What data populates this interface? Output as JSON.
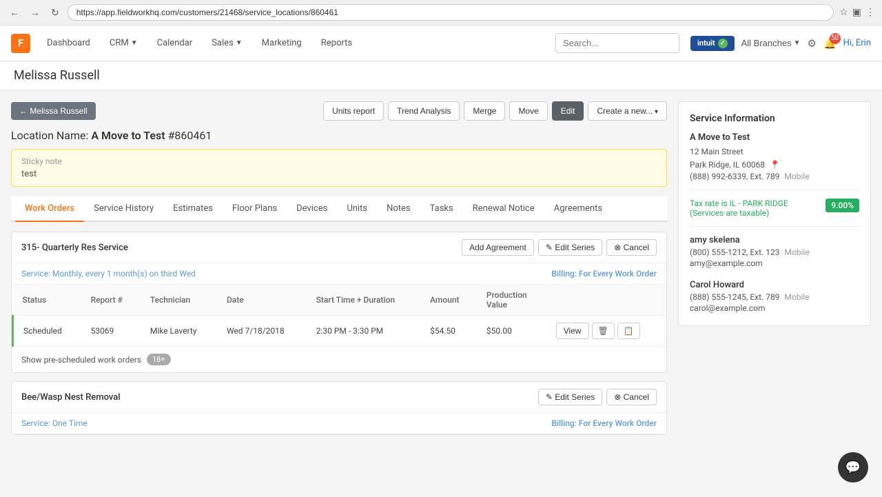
{
  "browser": {
    "url": "https://app.fieldworkhq.com/customers/21468/service_locations/860461"
  },
  "nav": {
    "logo": "F",
    "items": [
      {
        "label": "Dashboard",
        "id": "dashboard"
      },
      {
        "label": "CRM",
        "id": "crm",
        "dropdown": true
      },
      {
        "label": "Calendar",
        "id": "calendar"
      },
      {
        "label": "Sales",
        "id": "sales",
        "dropdown": true
      },
      {
        "label": "Marketing",
        "id": "marketing"
      },
      {
        "label": "Reports",
        "id": "reports"
      }
    ],
    "search_placeholder": "Search...",
    "branches_label": "All Branches",
    "notification_count": "50",
    "greeting": "Hi, Erin"
  },
  "page_title": "Melissa Russell",
  "back_button": "← Melissa Russell",
  "action_buttons": {
    "units_report": "Units report",
    "trend_analysis": "Trend Analysis",
    "merge": "Merge",
    "move": "Move",
    "edit": "Edit",
    "create_new": "Create a new..."
  },
  "location": {
    "label": "Location Name:",
    "name": "A Move to Test",
    "id": "#860461"
  },
  "sticky_note": {
    "label": "Sticky note",
    "text": "test"
  },
  "tabs": [
    {
      "label": "Work Orders",
      "active": true
    },
    {
      "label": "Service History"
    },
    {
      "label": "Estimates"
    },
    {
      "label": "Floor Plans"
    },
    {
      "label": "Devices"
    },
    {
      "label": "Units"
    },
    {
      "label": "Notes"
    },
    {
      "label": "Tasks"
    },
    {
      "label": "Renewal Notice"
    },
    {
      "label": "Agreements"
    }
  ],
  "work_orders": [
    {
      "id": "wo1",
      "title": "315- Quarterly Res Service",
      "service_text": "Service: Monthly, every 1 month(s) on third Wed",
      "billing_text": "Billing: For Every Work Order",
      "table_headers": [
        "Status",
        "Report #",
        "Technician",
        "Date",
        "Start Time + Duration",
        "Amount",
        "Production\nValue"
      ],
      "rows": [
        {
          "status": "Scheduled",
          "report": "53069",
          "technician": "Mike Laverty",
          "date": "Wed 7/18/2018",
          "time": "2:30 PM - 3:30 PM",
          "amount": "$54.50",
          "production_value": "$50.00"
        }
      ],
      "pre_scheduled_label": "Show pre-scheduled work orders",
      "pre_scheduled_count": "18+"
    },
    {
      "id": "wo2",
      "title": "Bee/Wasp Nest Removal",
      "service_text": "Service: One Time",
      "billing_text": "Billing: For Every Work Order",
      "rows": []
    }
  ],
  "sidebar": {
    "title": "Service Information",
    "location_name": "A Move to Test",
    "address_line1": "12 Main Street",
    "address_line2": "Park Ridge, IL 60068",
    "phone": "(888) 992-6339, Ext. 789",
    "phone_type": "Mobile",
    "tax_label": "Tax rate is IL - PARK RIDGE\n(Services are taxable)",
    "tax_rate": "9.00%",
    "contacts": [
      {
        "name": "amy skelena",
        "phone": "(800) 555-1212, Ext. 123",
        "phone_type": "Mobile",
        "email": "amy@example.com"
      },
      {
        "name": "Carol Howard",
        "phone": "(888) 555-1245, Ext. 789",
        "phone_type": "Mobile",
        "email": "carol@example.com"
      }
    ]
  }
}
